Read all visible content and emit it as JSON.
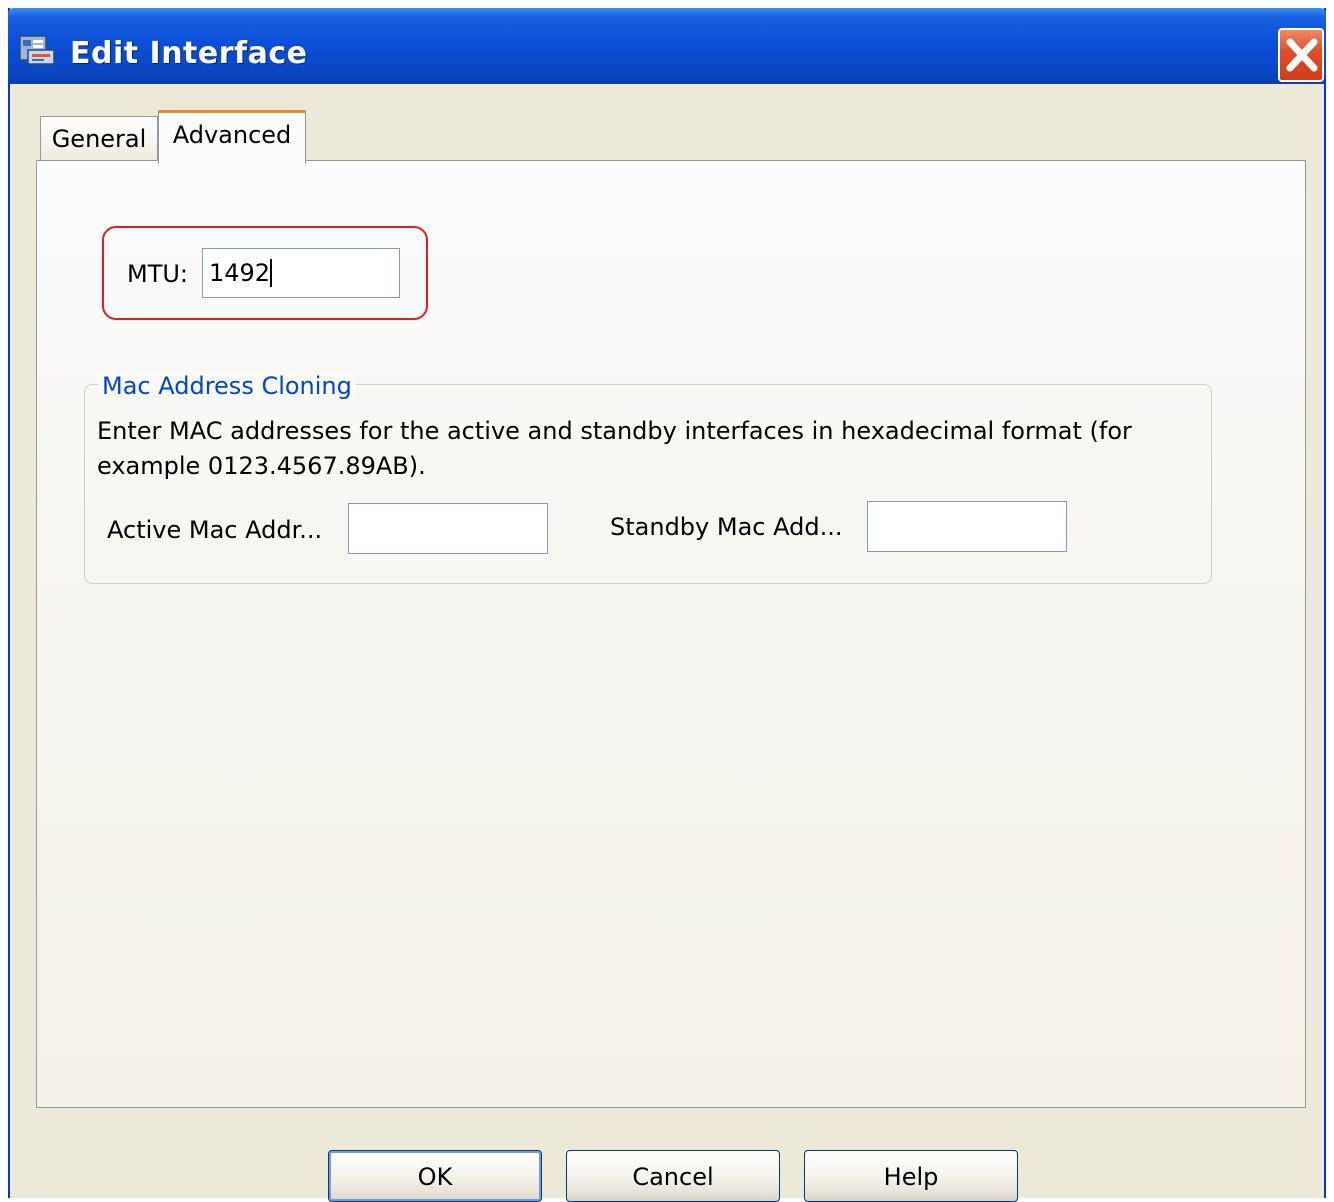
{
  "window": {
    "title": "Edit Interface",
    "icon": "asdm-app-icon",
    "close_icon": "close-icon"
  },
  "tabs": [
    {
      "label": "General",
      "selected": false
    },
    {
      "label": "Advanced",
      "selected": true
    }
  ],
  "mtu": {
    "label": "MTU:",
    "value": "1492"
  },
  "mac_cloning": {
    "title": "Mac Address Cloning",
    "description": "Enter MAC addresses for the active and standby interfaces in hexadecimal format (for example 0123.4567.89AB).",
    "active_label": "Active Mac Addr...",
    "active_value": "",
    "standby_label": "Standby Mac Add...",
    "standby_value": ""
  },
  "buttons": {
    "ok": "OK",
    "cancel": "Cancel",
    "help": "Help"
  },
  "colors": {
    "titlebar": "#0a4fd6",
    "highlight_annotation": "#e41d1d",
    "group_title": "#0046d5",
    "active_tab_accent": "#e68b2c"
  }
}
